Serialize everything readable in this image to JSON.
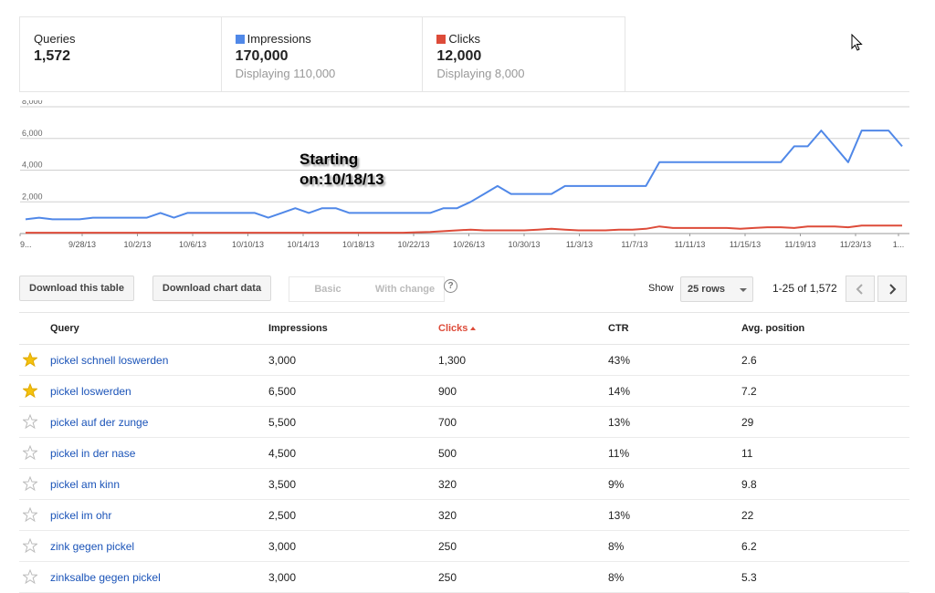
{
  "summary": {
    "queries": {
      "label": "Queries",
      "value": "1,572"
    },
    "impressions": {
      "label": "Impressions",
      "value": "170,000",
      "sub": "Displaying 110,000",
      "color": "#5088e8"
    },
    "clicks": {
      "label": "Clicks",
      "value": "12,000",
      "sub": "Displaying 8,000",
      "color": "#dd4b39"
    }
  },
  "chart_data": {
    "type": "line",
    "ylim": [
      0,
      8000
    ],
    "yticks": [
      "2,000",
      "4,000",
      "6,000",
      "8,000"
    ],
    "xticks": [
      "9...",
      "9/28/13",
      "10/2/13",
      "10/6/13",
      "10/10/13",
      "10/14/13",
      "10/18/13",
      "10/22/13",
      "10/26/13",
      "10/30/13",
      "11/3/13",
      "11/7/13",
      "11/11/13",
      "11/15/13",
      "11/19/13",
      "11/23/13",
      "1..."
    ],
    "annotation": "Starting on:10/18/13",
    "series": [
      {
        "color": "#5088e8",
        "values": [
          900,
          1000,
          900,
          900,
          900,
          1000,
          1000,
          1000,
          1000,
          1000,
          1300,
          1000,
          1300,
          1300,
          1300,
          1300,
          1300,
          1300,
          1000,
          1300,
          1600,
          1300,
          1600,
          1600,
          1300,
          1300,
          1300,
          1300,
          1300,
          1300,
          1300,
          1600,
          1600,
          2000,
          2500,
          3000,
          2500,
          2500,
          2500,
          2500,
          3000,
          3000,
          3000,
          3000,
          3000,
          3000,
          3000,
          4500,
          4500,
          4500,
          4500,
          4500,
          4500,
          4500,
          4500,
          4500,
          4500,
          5500,
          5500,
          6500,
          5500,
          4500,
          6500,
          6500,
          6500,
          5500
        ]
      },
      {
        "color": "#dd4b39",
        "values": [
          50,
          50,
          50,
          50,
          50,
          50,
          50,
          50,
          50,
          50,
          50,
          50,
          50,
          50,
          50,
          50,
          50,
          50,
          50,
          50,
          50,
          50,
          50,
          50,
          50,
          50,
          50,
          50,
          50,
          80,
          100,
          150,
          200,
          250,
          200,
          200,
          200,
          200,
          250,
          300,
          250,
          200,
          200,
          200,
          250,
          250,
          300,
          450,
          350,
          350,
          350,
          350,
          350,
          300,
          350,
          400,
          400,
          350,
          450,
          450,
          450,
          400,
          500,
          500,
          500,
          500
        ]
      }
    ]
  },
  "controls": {
    "download_table": "Download this table",
    "download_chart": "Download chart data",
    "basic": "Basic",
    "with_change": "With change",
    "help": "?",
    "show_label": "Show",
    "rows_select": "25 rows",
    "page_info": "1-25 of 1,572"
  },
  "table": {
    "headers": {
      "query": "Query",
      "impressions": "Impressions",
      "clicks": "Clicks",
      "ctr": "CTR",
      "position": "Avg. position"
    },
    "rows": [
      {
        "starred": true,
        "query": "pickel schnell loswerden",
        "impressions": "3,000",
        "clicks": "1,300",
        "ctr": "43%",
        "position": "2.6"
      },
      {
        "starred": true,
        "query": "pickel loswerden",
        "impressions": "6,500",
        "clicks": "900",
        "ctr": "14%",
        "position": "7.2"
      },
      {
        "starred": false,
        "query": "pickel auf der zunge",
        "impressions": "5,500",
        "clicks": "700",
        "ctr": "13%",
        "position": "29"
      },
      {
        "starred": false,
        "query": "pickel in der nase",
        "impressions": "4,500",
        "clicks": "500",
        "ctr": "11%",
        "position": "11"
      },
      {
        "starred": false,
        "query": "pickel am kinn",
        "impressions": "3,500",
        "clicks": "320",
        "ctr": "9%",
        "position": "9.8"
      },
      {
        "starred": false,
        "query": "pickel im ohr",
        "impressions": "2,500",
        "clicks": "320",
        "ctr": "13%",
        "position": "22"
      },
      {
        "starred": false,
        "query": "zink gegen pickel",
        "impressions": "3,000",
        "clicks": "250",
        "ctr": "8%",
        "position": "6.2"
      },
      {
        "starred": false,
        "query": "zinksalbe gegen pickel",
        "impressions": "3,000",
        "clicks": "250",
        "ctr": "8%",
        "position": "5.3"
      }
    ]
  }
}
